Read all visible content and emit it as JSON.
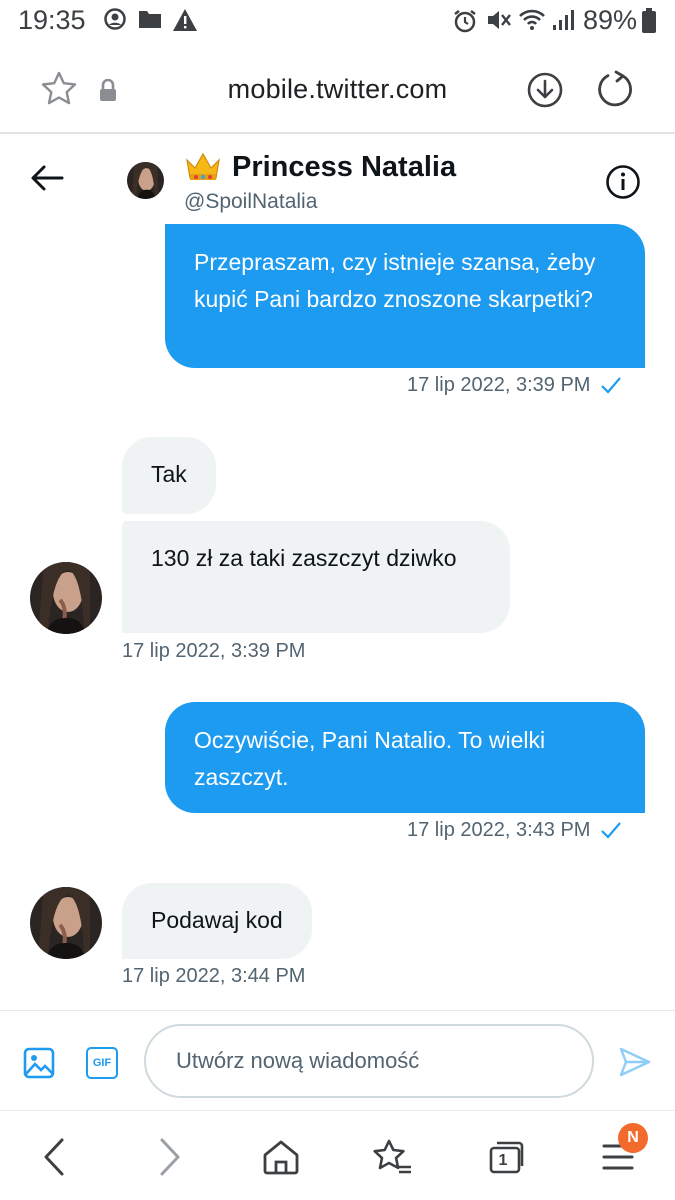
{
  "status_bar": {
    "time": "19:35",
    "battery": "89%"
  },
  "browser": {
    "url": "mobile.twitter.com",
    "tab_count": "1",
    "notification_badge": "N"
  },
  "conversation": {
    "name": "Princess Natalia",
    "handle": "@SpoilNatalia"
  },
  "messages": [
    {
      "direction": "out",
      "text": "Przepraszam, czy istnieje szansa, żeby kupić Pani bardzo znoszone skarpetki?",
      "timestamp": "17 lip 2022, 3:39 PM"
    },
    {
      "direction": "in",
      "text": "Tak"
    },
    {
      "direction": "in",
      "text": "130 zł za taki zaszczyt dziwko",
      "timestamp": "17 lip 2022, 3:39 PM"
    },
    {
      "direction": "out",
      "text": "Oczywiście, Pani Natalio. To wielki zaszczyt.",
      "timestamp": "17 lip 2022, 3:43 PM"
    },
    {
      "direction": "in",
      "text": "Podawaj kod",
      "timestamp": "17 lip 2022, 3:44 PM"
    }
  ],
  "composer": {
    "placeholder": "Utwórz nową wiadomość",
    "gif_label": "GIF"
  },
  "colors": {
    "accent": "#1d9bf0",
    "incoming_bubble": "#eff3f4",
    "badge": "#f26b2d"
  }
}
